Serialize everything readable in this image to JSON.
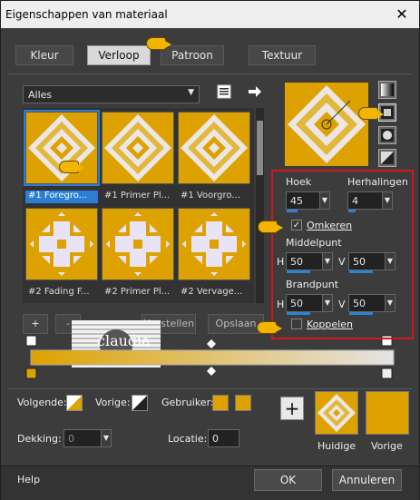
{
  "window": {
    "title": "Eigenschappen van materiaal",
    "close": "✕"
  },
  "tabs": [
    {
      "label": "Kleur"
    },
    {
      "label": "Verloop"
    },
    {
      "label": "Patroon"
    },
    {
      "label": "Textuur"
    }
  ],
  "gallery": {
    "category": "Alles",
    "items": [
      {
        "label": "#1 Foregro..."
      },
      {
        "label": "#1 Primer Pl..."
      },
      {
        "label": "#1 Voorgro..."
      },
      {
        "label": "#2 Fading F..."
      },
      {
        "label": "#2 Primer Pl..."
      },
      {
        "label": "#2 Vervage..."
      }
    ],
    "add": "+",
    "remove": "-",
    "herstellen": "Herstellen",
    "opslaan": "Opslaan"
  },
  "settings": {
    "hoek_label": "Hoek",
    "hoek_value": "45",
    "herhalingen_label": "Herhalingen",
    "herhalingen_value": "4",
    "omkeren_label": "Omkeren",
    "middelpunt_label": "Middelpunt",
    "mid_h_label": "H",
    "mid_h_value": "50",
    "mid_v_label": "V",
    "mid_v_value": "50",
    "brandpunt_label": "Brandpunt",
    "br_h_label": "H",
    "br_h_value": "50",
    "br_v_label": "V",
    "br_v_value": "50",
    "koppelen_label": "Koppelen"
  },
  "watermark": {
    "text": "claudia"
  },
  "bottom": {
    "volgende_label": "Volgende:",
    "vorige_label": "Vorige:",
    "gebruiker_label": "Gebruiker:",
    "dekking_label": "Dekking:",
    "dekking_value": "0",
    "locatie_label": "Locatie:",
    "locatie_value": "0",
    "plus": "+",
    "huidige_label": "Huidige",
    "vorige_swatch_label": "Vorige"
  },
  "dialog": {
    "help": "Help",
    "ok": "OK",
    "annuleren": "Annuleren"
  },
  "colors": {
    "gold": "#dea200",
    "light": "#e8e6f4",
    "accent": "#2a7fd4",
    "highlight": "#d0181d"
  }
}
